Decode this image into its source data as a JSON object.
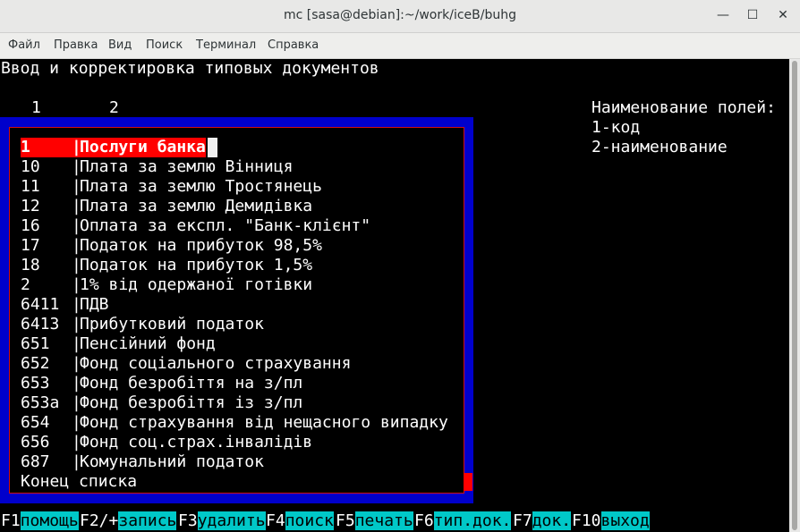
{
  "window": {
    "title": "mc [sasa@debian]:~/work/iceB/buhg",
    "minimize_glyph": "—",
    "maximize_glyph": "☐",
    "close_glyph": "✕"
  },
  "menu": [
    "Файл",
    "Правка",
    "Вид",
    "Поиск",
    "Терминал",
    "Справка"
  ],
  "screen": {
    "heading": "Ввод и корректировка типовых документов",
    "col1": "1",
    "col2": "2",
    "fields_title": "Наименование полей:",
    "field1": "1-код",
    "field2": "2-наименование"
  },
  "list": {
    "separator": "|",
    "rows": [
      {
        "code": "1",
        "name": "Послуги банка"
      },
      {
        "code": "10",
        "name": "Плата за землю Вінниця"
      },
      {
        "code": "11",
        "name": "Плата за землю Тростянець"
      },
      {
        "code": "12",
        "name": "Плата за землю Демидівка"
      },
      {
        "code": "16",
        "name": "Оплата за експл. \"Банк-клієнт\""
      },
      {
        "code": "17",
        "name": "Податок на прибуток 98,5%"
      },
      {
        "code": "18",
        "name": "Податок на прибуток 1,5%"
      },
      {
        "code": "2",
        "name": "1% від одержаної готівки"
      },
      {
        "code": "6411",
        "name": "ПДВ"
      },
      {
        "code": "6413",
        "name": "Прибутковий податок"
      },
      {
        "code": "651",
        "name": "Пенсійний фонд"
      },
      {
        "code": "652",
        "name": "Фонд соціального страхування"
      },
      {
        "code": "653",
        "name": "Фонд безробіття на з/пл"
      },
      {
        "code": "653а",
        "name": "Фонд безробіття із з/пл"
      },
      {
        "code": "654",
        "name": "Фонд страхування від нещасного випадку"
      },
      {
        "code": "656",
        "name": "Фонд соц.страх.інвалідів"
      },
      {
        "code": "687",
        "name": "Комунальний податок"
      }
    ],
    "footer": "Конец списка"
  },
  "fkeys": [
    {
      "key": "F1",
      "label": "помощь"
    },
    {
      "key": "F2/+",
      "label": "запись"
    },
    {
      "key": "F3",
      "label": "удалить"
    },
    {
      "key": "F4",
      "label": "поиск"
    },
    {
      "key": "F5",
      "label": "печать"
    },
    {
      "key": "F6",
      "label": "тип.док."
    },
    {
      "key": "F7",
      "label": "док."
    },
    {
      "key": "F10",
      "label": "выход"
    }
  ]
}
